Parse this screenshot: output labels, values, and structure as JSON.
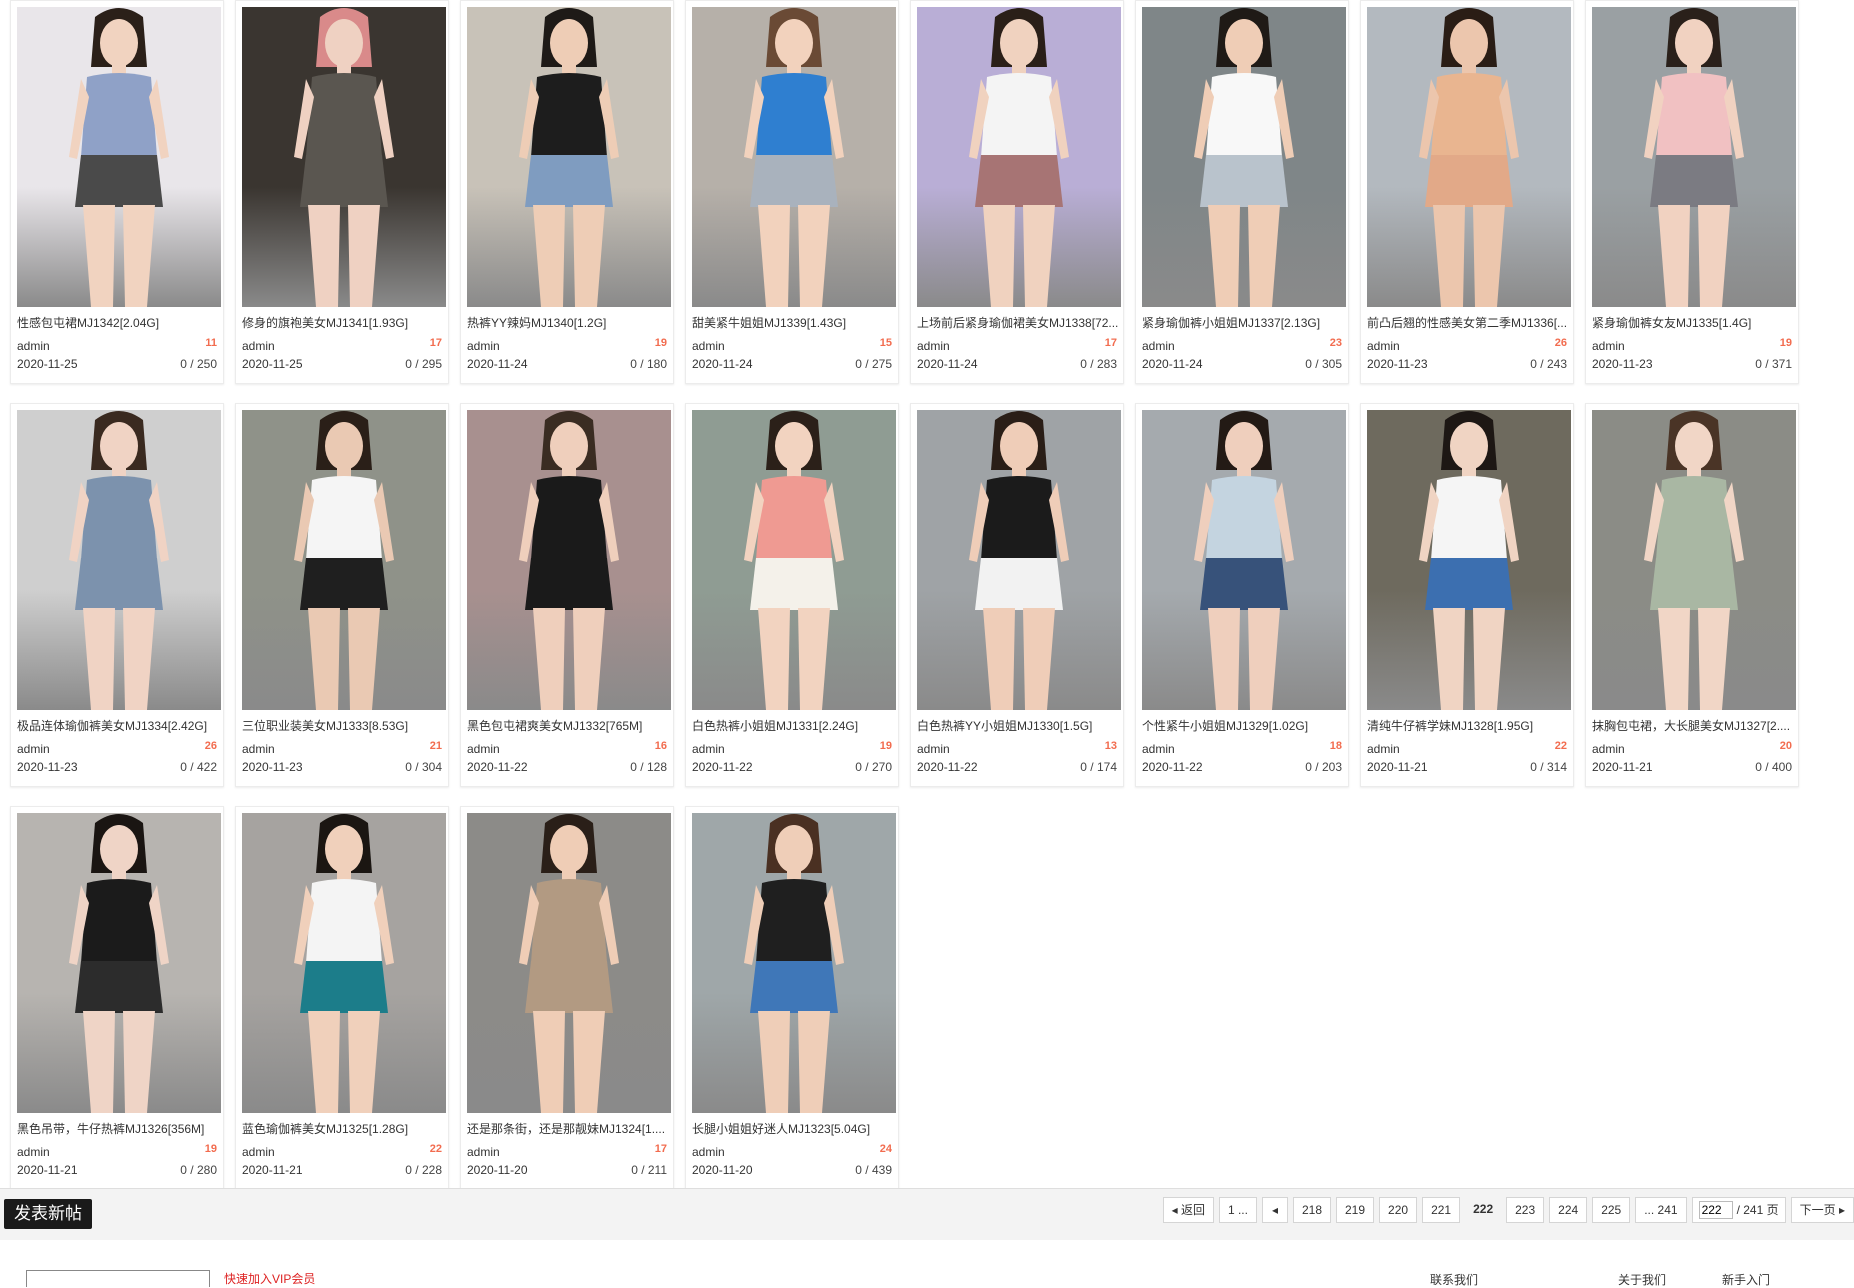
{
  "threads": [
    {
      "title": "性感包屯裙MJ1342[2.04G]",
      "author": "admin",
      "replies": "11",
      "date": "2020-11-25",
      "stats": "0 / 250",
      "bg": "#e9e6ea",
      "top": "#8fa1c7",
      "bottom": "#4a4a4a",
      "skin": "#f1d3c0",
      "hair": "#2b2019"
    },
    {
      "title": "修身的旗袍美女MJ1341[1.93G]",
      "author": "admin",
      "replies": "17",
      "date": "2020-11-25",
      "stats": "0 / 295",
      "bg": "#3a3530",
      "top": "#5a5650",
      "bottom": "#5a5650",
      "skin": "#efd1c2",
      "hair": "#d98a8a"
    },
    {
      "title": "热裤YY辣妈MJ1340[1.2G]",
      "author": "admin",
      "replies": "19",
      "date": "2020-11-24",
      "stats": "0 / 180",
      "bg": "#c8c2b8",
      "top": "#1d1d1d",
      "bottom": "#7f9cc0",
      "skin": "#eecdb6",
      "hair": "#1e1a17"
    },
    {
      "title": "甜美紧牛姐姐MJ1339[1.43G]",
      "author": "admin",
      "replies": "15",
      "date": "2020-11-24",
      "stats": "0 / 275",
      "bg": "#b6b0a9",
      "top": "#2f7fd0",
      "bottom": "#a9b2bd",
      "skin": "#f2d2bd",
      "hair": "#6a4a35"
    },
    {
      "title": "上场前后紧身瑜伽裙美女MJ1338[72...",
      "author": "admin",
      "replies": "17",
      "date": "2020-11-24",
      "stats": "0 / 283",
      "bg": "#b9aed6",
      "top": "#f4f4f4",
      "bottom": "#a77474",
      "skin": "#f0d2bf",
      "hair": "#2a1f18"
    },
    {
      "title": "紧身瑜伽裤小姐姐MJ1337[2.13G]",
      "author": "admin",
      "replies": "23",
      "date": "2020-11-24",
      "stats": "0 / 305",
      "bg": "#7f8688",
      "top": "#f8f8f8",
      "bottom": "#b9c3cc",
      "skin": "#efcdb6",
      "hair": "#1f1a16"
    },
    {
      "title": "前凸后翘的性感美女第二季MJ1336[...",
      "author": "admin",
      "replies": "26",
      "date": "2020-11-23",
      "stats": "0 / 243",
      "bg": "#b3b9bf",
      "top": "#e9b590",
      "bottom": "#e2a988",
      "skin": "#ecc6ad",
      "hair": "#2a1d15"
    },
    {
      "title": "紧身瑜伽裤女友MJ1335[1.4G]",
      "author": "admin",
      "replies": "19",
      "date": "2020-11-23",
      "stats": "0 / 371",
      "bg": "#9aa0a3",
      "top": "#f1c1c2",
      "bottom": "#7b7b82",
      "skin": "#f1d2c1",
      "hair": "#2a201a"
    },
    {
      "title": "极品连体瑜伽裤美女MJ1334[2.42G]",
      "author": "admin",
      "replies": "26",
      "date": "2020-11-23",
      "stats": "0 / 422",
      "bg": "#cfcfcf",
      "top": "#7c92ad",
      "bottom": "#7c92ad",
      "skin": "#f0d3c4",
      "hair": "#3a2a20"
    },
    {
      "title": "三位职业装美女MJ1333[8.53G]",
      "author": "admin",
      "replies": "21",
      "date": "2020-11-23",
      "stats": "0 / 304",
      "bg": "#8f9289",
      "top": "#f5f5f5",
      "bottom": "#1f1f1f",
      "skin": "#eac9b3",
      "hair": "#2a1f18"
    },
    {
      "title": "黑色包屯裙爽美女MJ1332[765M]",
      "author": "admin",
      "replies": "16",
      "date": "2020-11-22",
      "stats": "0 / 128",
      "bg": "#a8908f",
      "top": "#1a1a1a",
      "bottom": "#1a1a1a",
      "skin": "#efcfbc",
      "hair": "#3a2c22"
    },
    {
      "title": "白色热裤小姐姐MJ1331[2.24G]",
      "author": "admin",
      "replies": "19",
      "date": "2020-11-22",
      "stats": "0 / 270",
      "bg": "#8f9c93",
      "top": "#ef9a92",
      "bottom": "#f4f1ea",
      "skin": "#f2d3c0",
      "hair": "#2b2019"
    },
    {
      "title": "白色热裤YY小姐姐MJ1330[1.5G]",
      "author": "admin",
      "replies": "13",
      "date": "2020-11-22",
      "stats": "0 / 174",
      "bg": "#9fa3a6",
      "top": "#1b1b1b",
      "bottom": "#f2f2f2",
      "skin": "#efcdb8",
      "hair": "#2a1e17"
    },
    {
      "title": "个性紧牛小姐姐MJ1329[1.02G]",
      "author": "admin",
      "replies": "18",
      "date": "2020-11-22",
      "stats": "0 / 203",
      "bg": "#a5aaae",
      "top": "#c4d4e0",
      "bottom": "#37527a",
      "skin": "#efcfbd",
      "hair": "#231a15"
    },
    {
      "title": "清纯牛仔裤学妹MJ1328[1.95G]",
      "author": "admin",
      "replies": "22",
      "date": "2020-11-21",
      "stats": "0 / 314",
      "bg": "#6e6a5e",
      "top": "#f5f5f5",
      "bottom": "#3c6fb0",
      "skin": "#f0d4c3",
      "hair": "#1d1714"
    },
    {
      "title": "抹胸包屯裙，大长腿美女MJ1327[2....",
      "author": "admin",
      "replies": "20",
      "date": "2020-11-21",
      "stats": "0 / 400",
      "bg": "#8b8c86",
      "top": "#a9b7a3",
      "bottom": "#a9b7a3",
      "skin": "#f1d6c6",
      "hair": "#4a3426"
    },
    {
      "title": "黑色吊带，牛仔热裤MJ1326[356M]",
      "author": "admin",
      "replies": "19",
      "date": "2020-11-21",
      "stats": "0 / 280",
      "bg": "#b7b4b0",
      "top": "#1b1b1b",
      "bottom": "#2c2c2c",
      "skin": "#efd4c6",
      "hair": "#1a1512"
    },
    {
      "title": "蓝色瑜伽裤美女MJ1325[1.28G]",
      "author": "admin",
      "replies": "22",
      "date": "2020-11-21",
      "stats": "0 / 228",
      "bg": "#a6a3a0",
      "top": "#f4f4f4",
      "bottom": "#1c7d8a",
      "skin": "#f0d0bb",
      "hair": "#1b1612"
    },
    {
      "title": "还是那条街，还是那靓妹MJ1324[1....",
      "author": "admin",
      "replies": "17",
      "date": "2020-11-20",
      "stats": "0 / 211",
      "bg": "#8c8b88",
      "top": "#b29a82",
      "bottom": "#b29a82",
      "skin": "#efcdb6",
      "hair": "#2a1f18"
    },
    {
      "title": "长腿小姐姐好迷人MJ1323[5.04G]",
      "author": "admin",
      "replies": "24",
      "date": "2020-11-20",
      "stats": "0 / 439",
      "bg": "#9fa7a9",
      "top": "#1f1f1f",
      "bottom": "#3f77b8",
      "skin": "#efceb8",
      "hair": "#4a3022"
    }
  ],
  "toolbar": {
    "new_post": "发表新帖"
  },
  "pager": {
    "back": "返回",
    "first": "1 ...",
    "pages": [
      "218",
      "219",
      "220",
      "221"
    ],
    "current": "222",
    "pages_after": [
      "223",
      "224",
      "225"
    ],
    "last": "... 241",
    "input_value": "222",
    "total": "/ 241 页",
    "next": "下一页"
  },
  "footer": {
    "red_link": "快速加入VIP会员",
    "item1": "联系我们",
    "item2": "关于我们",
    "item3": "新手入门"
  },
  "icons": {
    "prev": "caret-left-icon",
    "next": "caret-right-icon"
  }
}
